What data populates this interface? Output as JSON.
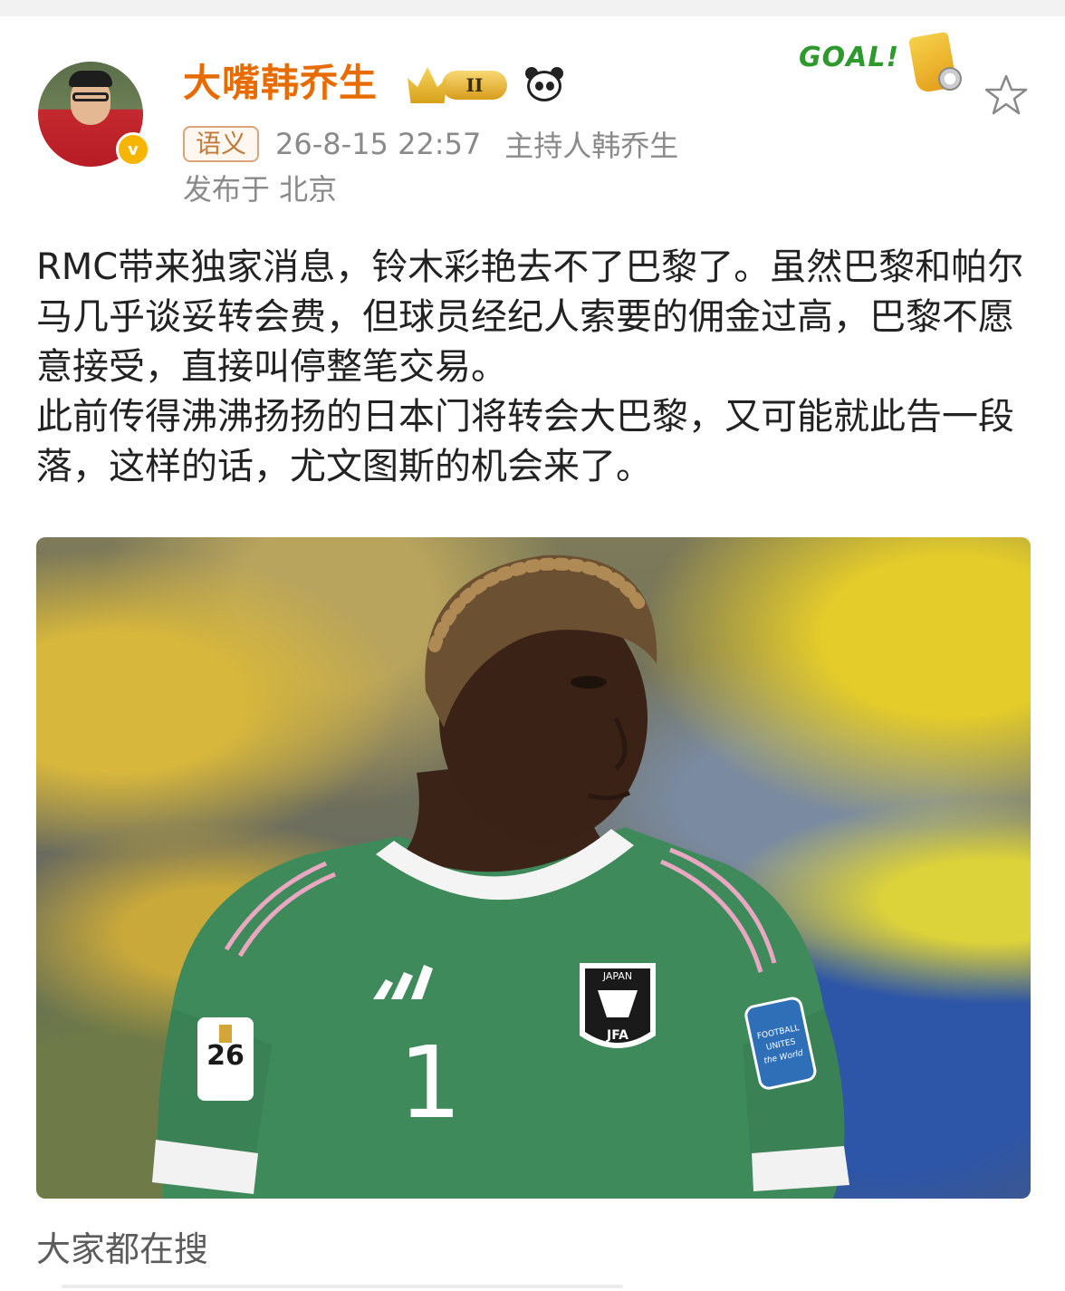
{
  "user": {
    "name": "大嘴韩乔生",
    "level_badge": "II",
    "verified_mark": "v",
    "icons": [
      "crown-icon",
      "panda-icon",
      "goal-badge-icon",
      "star-icon"
    ]
  },
  "goal_badge": {
    "text": "GOAL!"
  },
  "post": {
    "tag": "语义",
    "timestamp": "26-8-15 22:57",
    "source": "主持人韩乔生",
    "location": "发布于 北京",
    "paragraphs": [
      "RMC带来独家消息，铃木彩艳去不了巴黎了。虽然巴黎和帕尔马几乎谈妥转会费，但球员经纪人索要的佣金过高，巴黎不愿意接受，直接叫停整笔交易。",
      "此前传得沸沸扬扬的日本门将转会大巴黎，又可能就此告一段落，这样的话，尤文图斯的机会来了。"
    ]
  },
  "photo": {
    "jersey_number": "1",
    "crest_text": "JAPAN",
    "crest_sub": "JFA",
    "sleeve_patch_text": "FOOTBALL UNITES the World",
    "wc_patch_text": "26"
  },
  "footer": {
    "search_label": "大家都在搜"
  },
  "colors": {
    "username": "#e86b00",
    "meta": "#8a8a8a",
    "jersey": "#3e8a5a",
    "goal_green": "#2e9a2e"
  }
}
